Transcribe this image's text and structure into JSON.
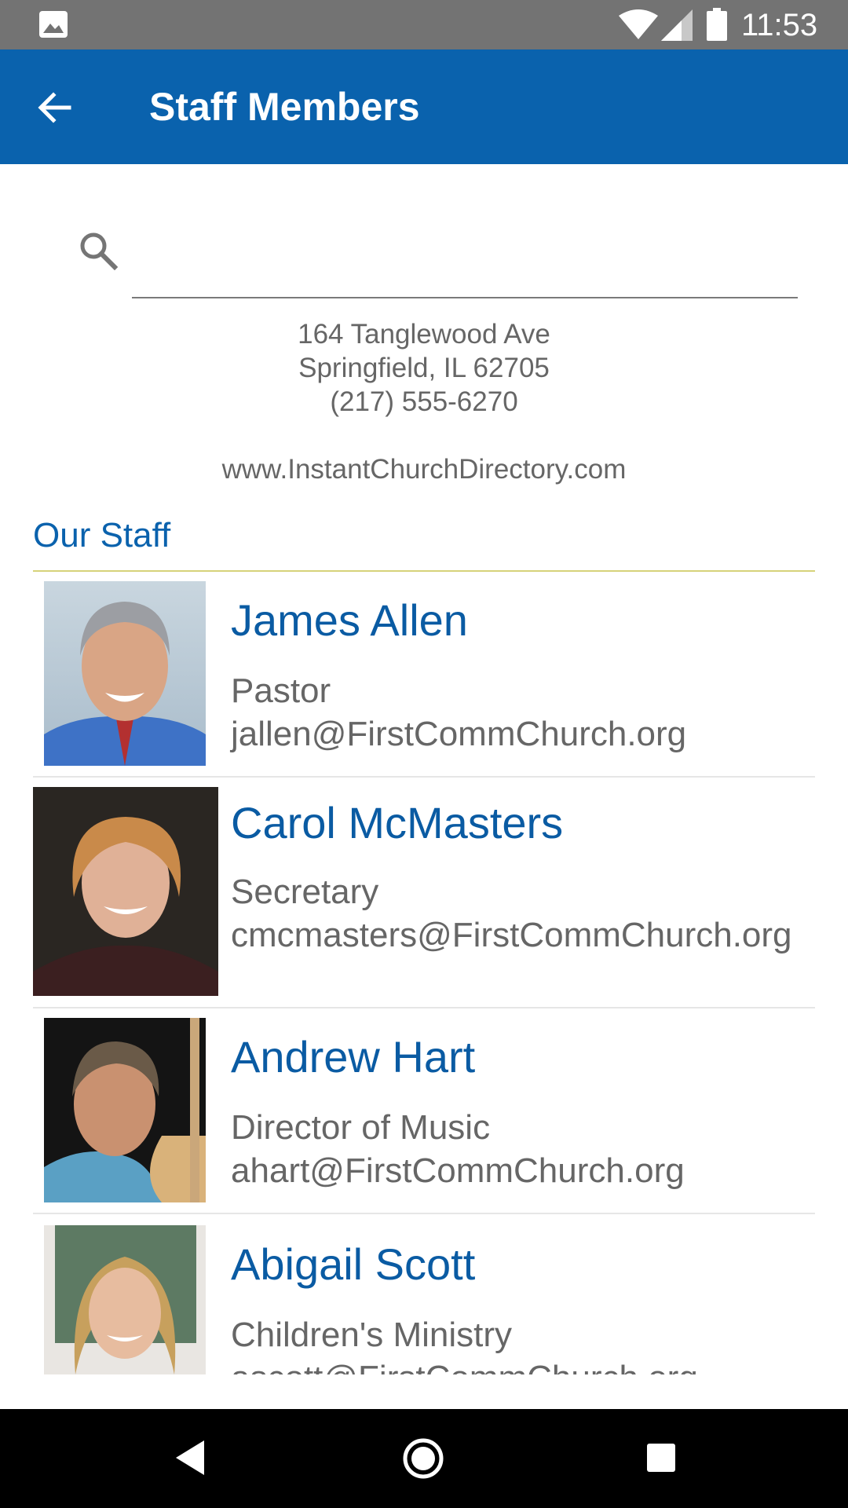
{
  "status_bar": {
    "time": "11:53",
    "icons": [
      "image-icon",
      "wifi-icon",
      "signal-icon",
      "battery-icon"
    ]
  },
  "app_bar": {
    "title": "Staff Members",
    "back_icon": "arrow-left-icon",
    "color": "#0a62ad"
  },
  "search": {
    "placeholder": "",
    "value": ""
  },
  "church": {
    "address_line1": "164 Tanglewood Ave",
    "address_line2": "Springfield, IL 62705",
    "phone": "(217) 555-6270",
    "website": "www.InstantChurchDirectory.com"
  },
  "section": {
    "title": "Our Staff"
  },
  "staff": [
    {
      "name": "James Allen",
      "role": "Pastor",
      "email": "jallen@FirstCommChurch.org"
    },
    {
      "name": "Carol McMasters",
      "role": "Secretary",
      "email": "cmcmasters@FirstCommChurch.org"
    },
    {
      "name": "Andrew Hart",
      "role": "Director of Music",
      "email": "ahart@FirstCommChurch.org"
    },
    {
      "name": "Abigail Scott",
      "role": "Children's Ministry",
      "email": "ascott@FirstCommChurch.org"
    }
  ],
  "nav_bar": {
    "icons": [
      "nav-back-icon",
      "nav-home-icon",
      "nav-recents-icon"
    ]
  }
}
